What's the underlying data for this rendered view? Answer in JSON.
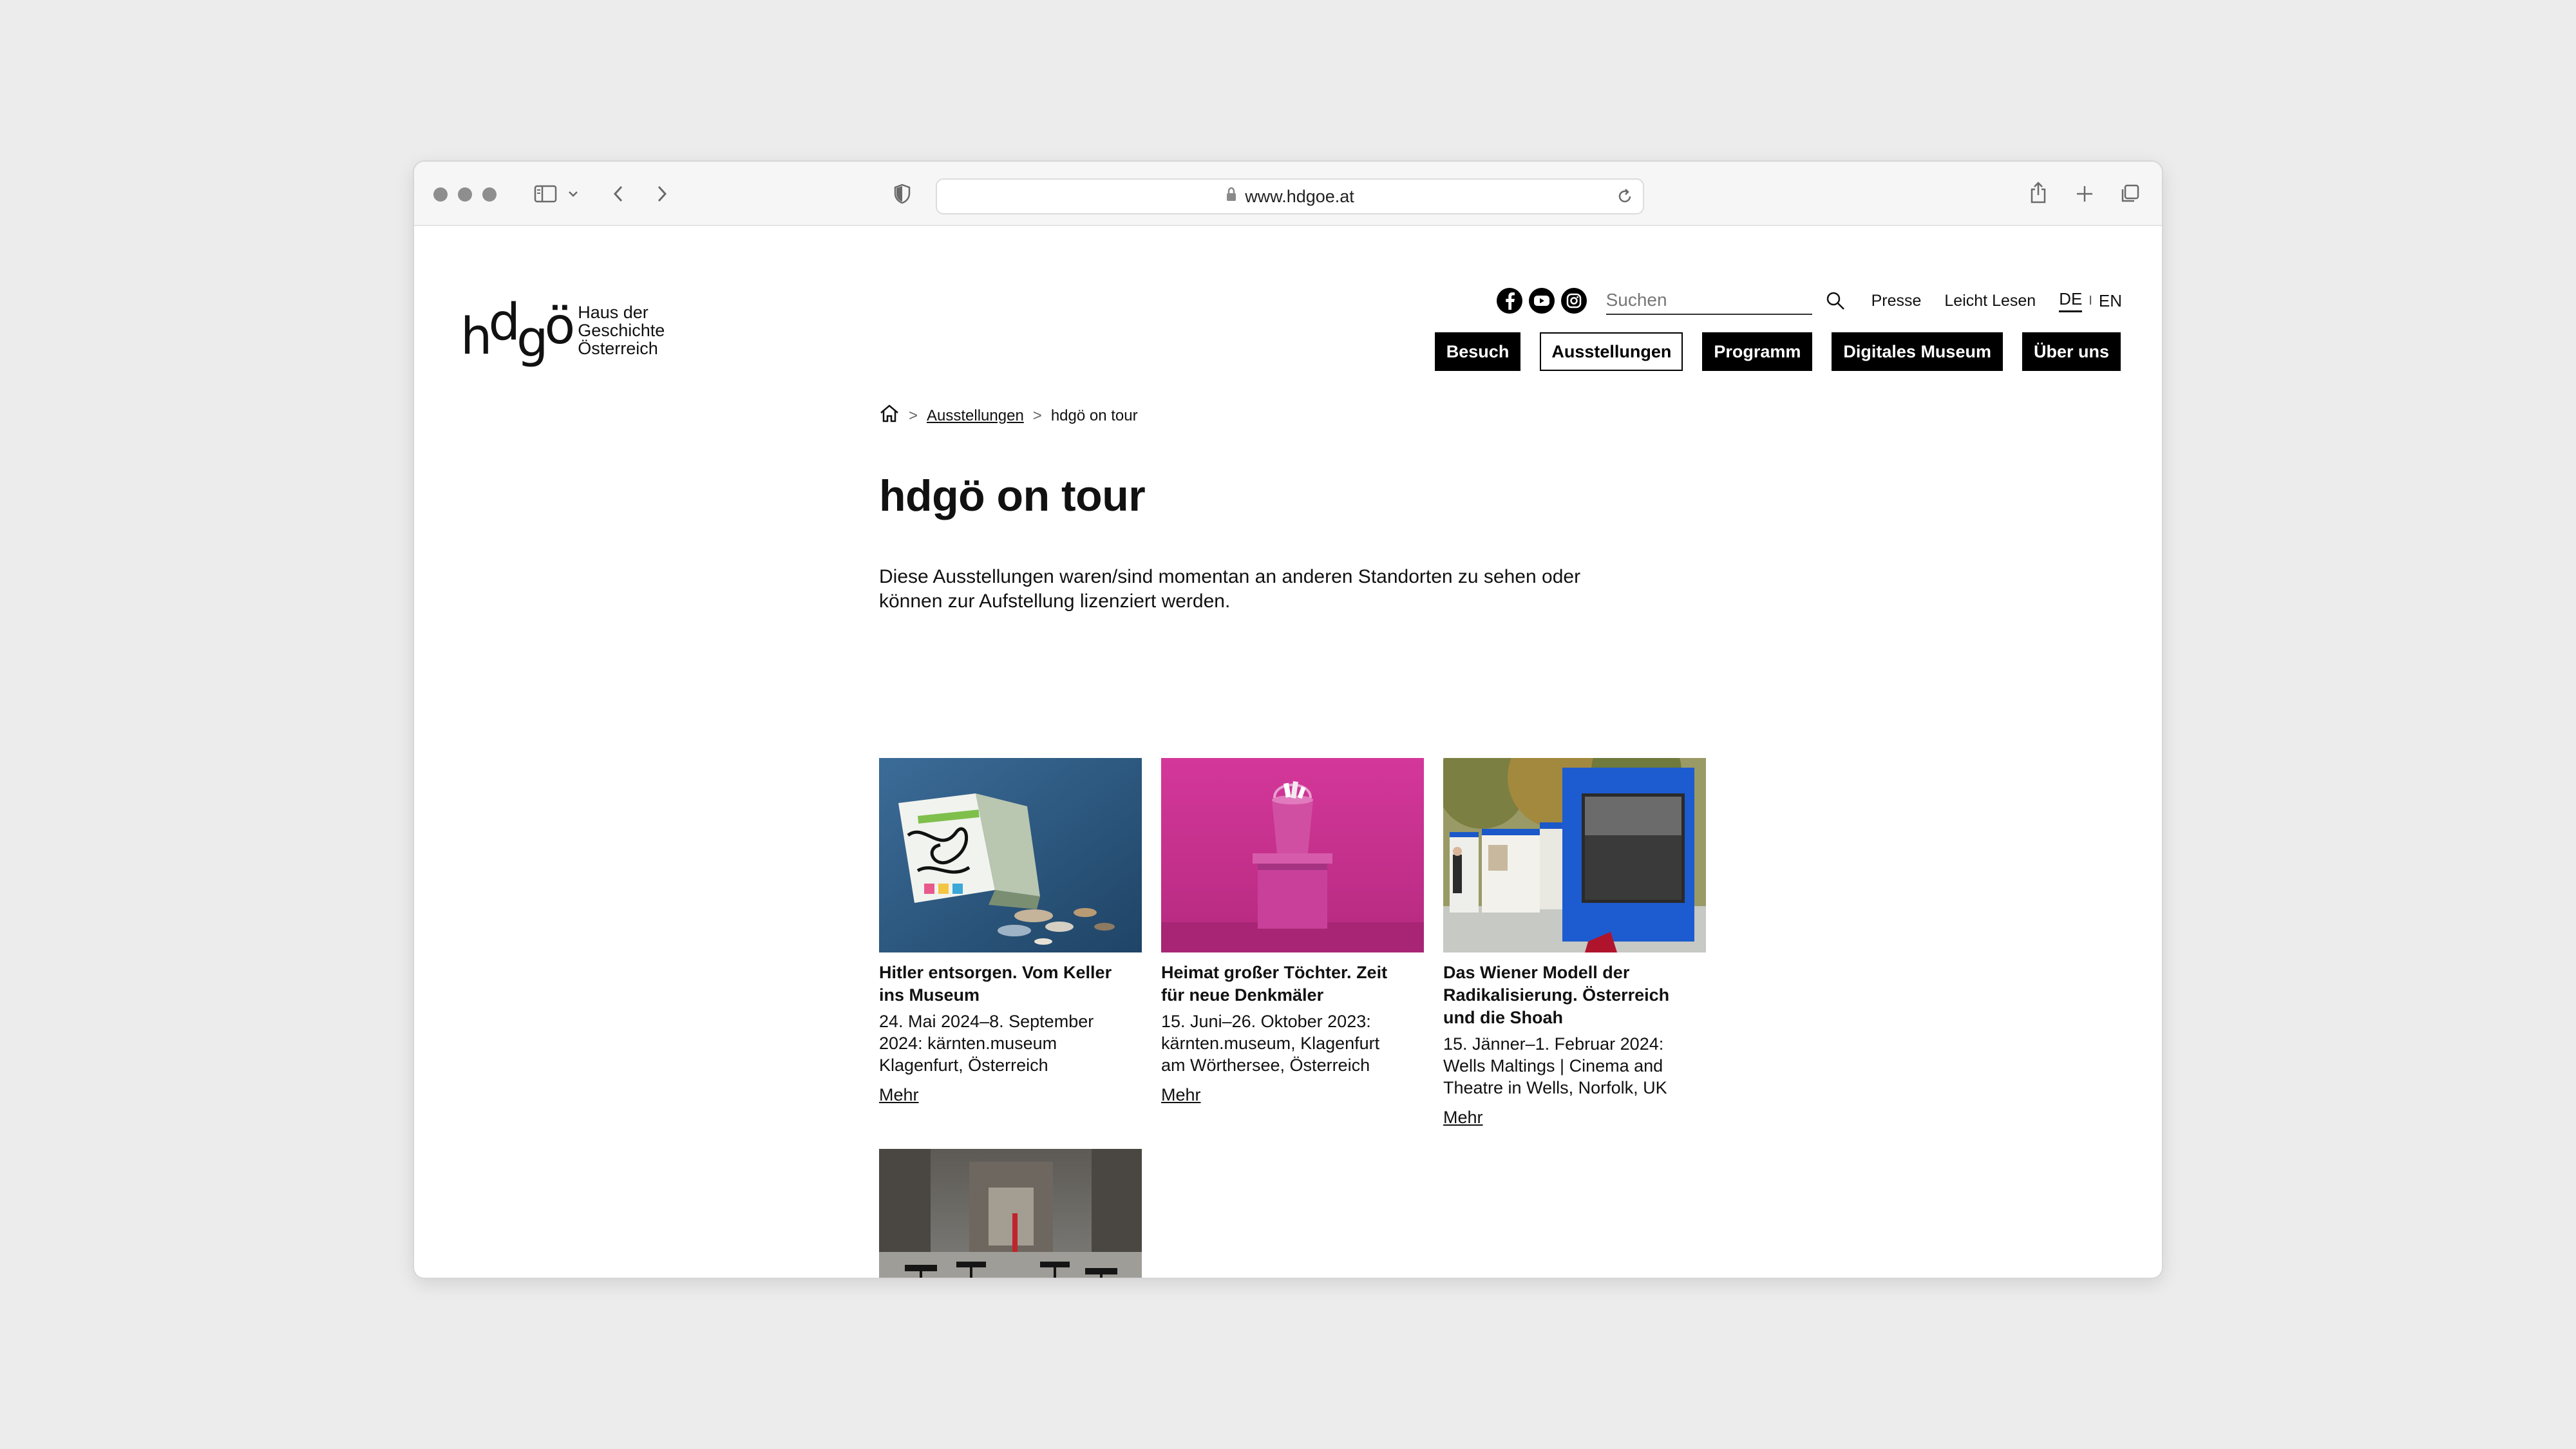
{
  "browser": {
    "url": "www.hdgoe.at"
  },
  "logo": {
    "mark": "hdgö",
    "line1": "Haus der",
    "line2": "Geschichte",
    "line3": "Österreich"
  },
  "utility": {
    "search_placeholder": "Suchen",
    "presse": "Presse",
    "leicht_lesen": "Leicht Lesen",
    "lang_de": "DE",
    "lang_sep": "I",
    "lang_en": "EN"
  },
  "nav": {
    "besuch": "Besuch",
    "ausstellungen": "Ausstellungen",
    "programm": "Programm",
    "digitales_museum": "Digitales Museum",
    "ueber_uns": "Über uns"
  },
  "breadcrumb": {
    "sep": ">",
    "parent": "Ausstellungen",
    "current": "hdgö on tour"
  },
  "page": {
    "title": "hdgö on tour",
    "intro_line1": "Diese Ausstellungen waren/sind momentan an anderen Standorten zu sehen oder",
    "intro_line2": "können zur Aufstellung lizenziert werden."
  },
  "cards": [
    {
      "title_line1": "Hitler entsorgen. Vom Keller",
      "title_line2": "ins Museum",
      "meta_line1": "24. Mai 2024–8. September",
      "meta_line2": "2024: kärnten.museum",
      "meta_line3": "Klagenfurt, Österreich",
      "more": "Mehr"
    },
    {
      "title_line1": "Heimat großer Töchter. Zeit",
      "title_line2": "für neue Denkmäler",
      "meta_line1": "15. Juni–26. Oktober 2023:",
      "meta_line2": "kärnten.museum, Klagenfurt",
      "meta_line3": "am Wörthersee, Österreich",
      "more": "Mehr"
    },
    {
      "title_line1": "Das Wiener Modell der",
      "title_line2": "Radikalisierung. Österreich",
      "title_line3": "und die Shoah",
      "meta_line1": "15. Jänner–1. Februar 2024:",
      "meta_line2": "Wells Maltings | Cinema and",
      "meta_line3": "Theatre in Wells, Norfolk, UK",
      "more": "Mehr"
    }
  ],
  "colors": {
    "accent": "#000000",
    "background": "#ffffff",
    "frame": "#ececec"
  }
}
